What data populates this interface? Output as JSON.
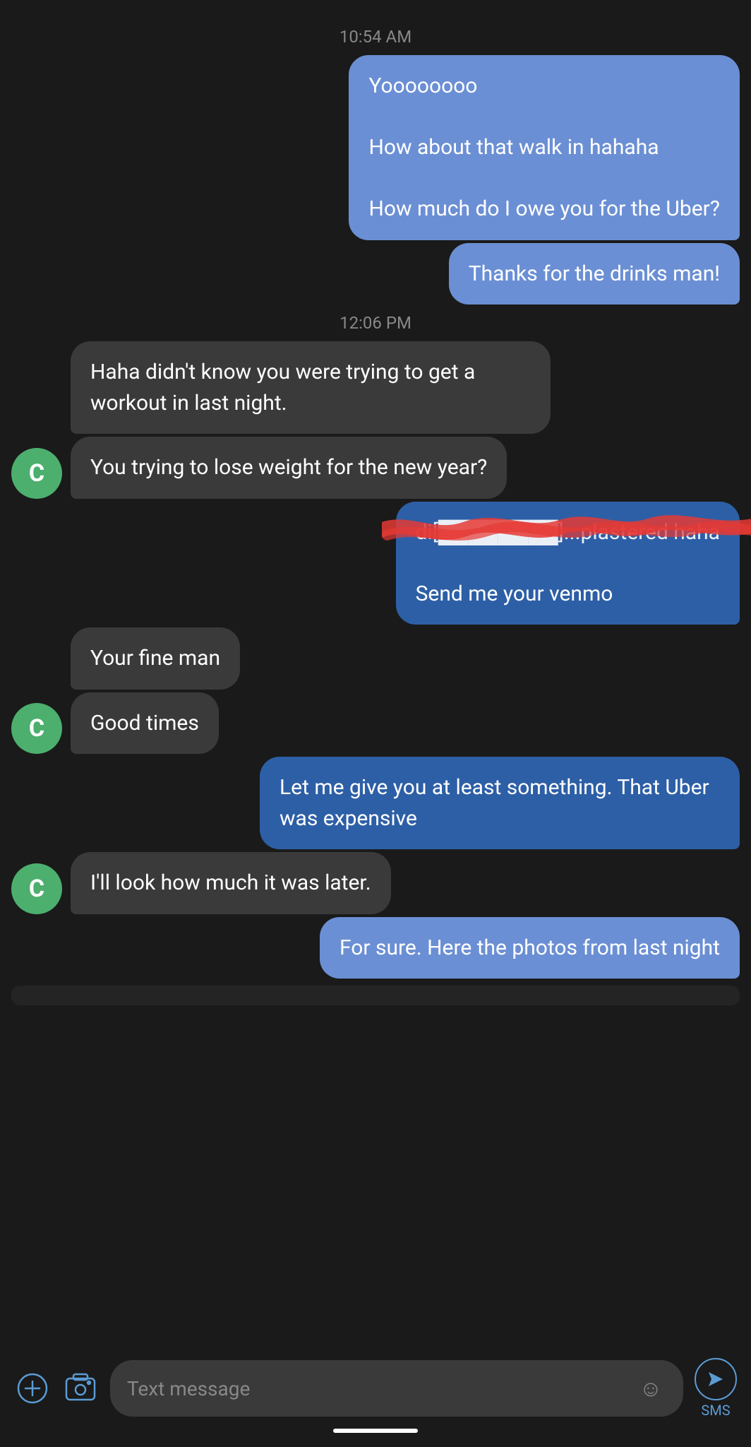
{
  "timestamps": {
    "first": "10:54 AM",
    "second": "12:06 PM"
  },
  "messages": [
    {
      "id": "m1",
      "type": "sent",
      "color": "light-blue",
      "text": "Yoooooooo\n\nHow about that walk in hahaha\n\nHow much do I owe you for the Uber?"
    },
    {
      "id": "m2",
      "type": "sent",
      "color": "light-blue",
      "text": "Thanks for the drinks man!"
    },
    {
      "id": "m3",
      "type": "received",
      "text": "Haha didn't know you were trying to get a workout in last night."
    },
    {
      "id": "m4",
      "type": "received",
      "text": "You trying to lose weight for the new year?"
    },
    {
      "id": "m5",
      "type": "sent",
      "color": "dark-blue",
      "text_line1": "di[redacted]...plastered haha",
      "text_line2": "Send me your venmo",
      "redacted": true
    },
    {
      "id": "m6",
      "type": "received",
      "text": "Your fine man"
    },
    {
      "id": "m7",
      "type": "received",
      "text": "Good times"
    },
    {
      "id": "m8",
      "type": "sent",
      "color": "dark-blue",
      "text": "Let me give you at least something. That Uber was expensive"
    },
    {
      "id": "m9",
      "type": "received",
      "text": "I'll look how much it was later."
    },
    {
      "id": "m10",
      "type": "sent",
      "color": "light-blue",
      "text": "For sure. Here the photos from last night"
    }
  ],
  "input": {
    "placeholder": "Text message"
  },
  "avatar_label": "C",
  "sms_label": "SMS"
}
